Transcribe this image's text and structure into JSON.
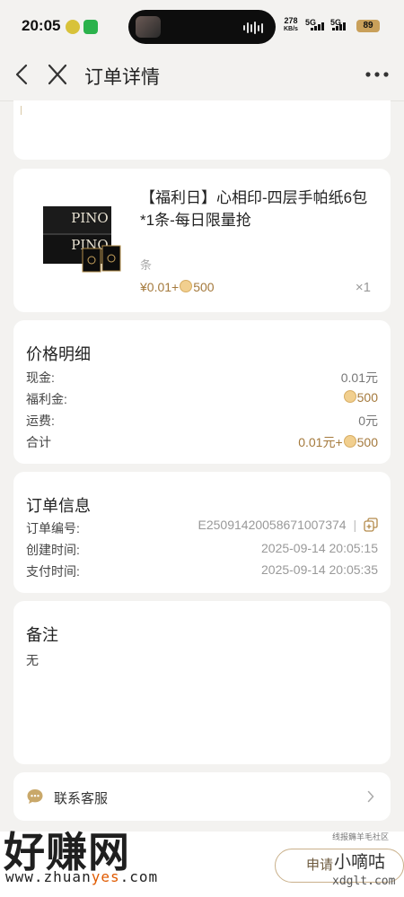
{
  "status_bar": {
    "time": "20:05",
    "net_speed_value": "278",
    "net_speed_unit": "KB/s",
    "signal_1": "5G",
    "signal_2": "5G",
    "battery": "89"
  },
  "nav": {
    "title": "订单详情",
    "back_icon": "chevron-left-icon",
    "close_icon": "close-icon",
    "more_icon": "more-dots-icon"
  },
  "product": {
    "name": "【福利日】心相印-四层手帕纸6包*1条-每日限量抢",
    "image_brand": "PINO",
    "spec": "条",
    "price_cash": "¥0.01+",
    "price_points": "500",
    "quantity": "×1"
  },
  "price_detail": {
    "title": "价格明细",
    "rows": [
      {
        "label": "现金:",
        "value": "0.01元"
      },
      {
        "label": "福利金:",
        "value": "500"
      },
      {
        "label": "运费:",
        "value": "0元"
      },
      {
        "label": "合计",
        "value_cash": "0.01元+",
        "value_points": "500"
      }
    ]
  },
  "order_info": {
    "title": "订单信息",
    "rows": [
      {
        "label": "订单编号:",
        "value": "E25091420058671007374"
      },
      {
        "label": "创建时间:",
        "value": "2025-09-14 20:05:15"
      },
      {
        "label": "支付时间:",
        "value": "2025-09-14 20:05:35"
      }
    ]
  },
  "remark": {
    "title": "备注",
    "value": "无"
  },
  "service": {
    "label": "联系客服"
  },
  "bottom": {
    "apply_label": "申请"
  },
  "watermarks": {
    "site_name": "好赚网",
    "site_url_prefix": "www.zhuan",
    "site_url_highlight": "yes",
    "site_url_suffix": ".com",
    "right_small": "线报薅羊毛社区",
    "right_name": "小嘀咕",
    "right_url": "xdglt.com"
  },
  "colors": {
    "accent_gold": "#a4793c",
    "page_bg": "#f3f2f0"
  }
}
